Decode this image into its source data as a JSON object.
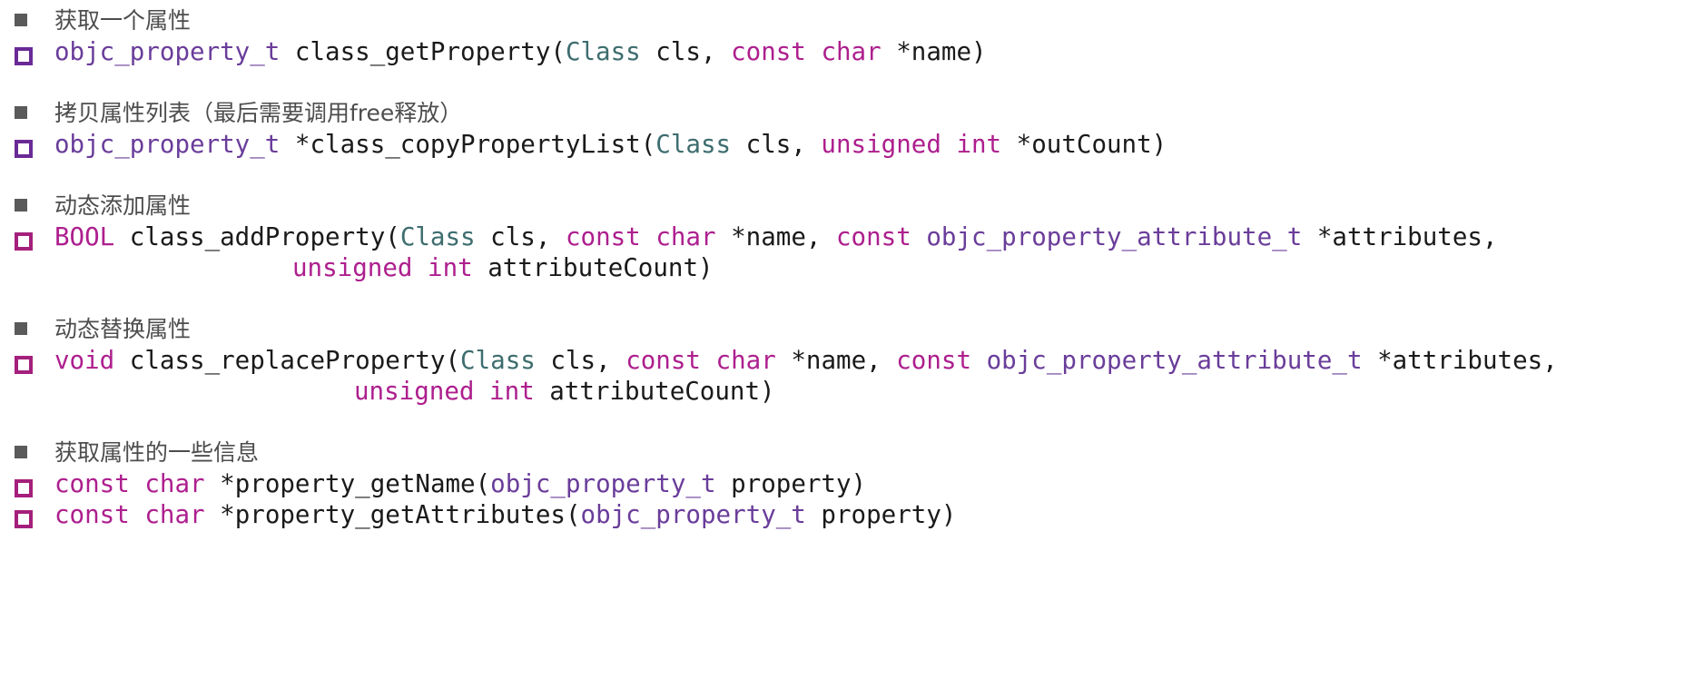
{
  "colors": {
    "keyword": "#ad1f8e",
    "type": "#6a3d9a",
    "class": "#3e6d6f",
    "plain": "#1a1a1a",
    "heading": "#4d4d4d",
    "bullet_square": "#5a5a5a",
    "bullet_hollow_purple": "#6a2a96",
    "bullet_hollow_magenta": "#a4207c"
  },
  "sections": [
    {
      "heading": "获取一个属性",
      "lines": [
        [
          {
            "t": "objc_property_t",
            "c": "ty"
          },
          {
            "t": " class_getProperty(",
            "c": "pl"
          },
          {
            "t": "Class",
            "c": "cl"
          },
          {
            "t": " cls, ",
            "c": "pl"
          },
          {
            "t": "const",
            "c": "kw"
          },
          {
            "t": " ",
            "c": "pl"
          },
          {
            "t": "char",
            "c": "kw"
          },
          {
            "t": " *name)",
            "c": "pl"
          }
        ]
      ]
    },
    {
      "heading": "拷贝属性列表（最后需要调用free释放）",
      "lines": [
        [
          {
            "t": "objc_property_t",
            "c": "ty"
          },
          {
            "t": " *class_copyPropertyList(",
            "c": "pl"
          },
          {
            "t": "Class",
            "c": "cl"
          },
          {
            "t": " cls, ",
            "c": "pl"
          },
          {
            "t": "unsigned",
            "c": "kw"
          },
          {
            "t": " ",
            "c": "pl"
          },
          {
            "t": "int",
            "c": "kw"
          },
          {
            "t": " *outCount)",
            "c": "pl"
          }
        ]
      ]
    },
    {
      "heading": "动态添加属性",
      "lines": [
        [
          {
            "t": "BOOL",
            "c": "kw"
          },
          {
            "t": " class_addProperty(",
            "c": "pl"
          },
          {
            "t": "Class",
            "c": "cl"
          },
          {
            "t": " cls, ",
            "c": "pl"
          },
          {
            "t": "const",
            "c": "kw"
          },
          {
            "t": " ",
            "c": "pl"
          },
          {
            "t": "char",
            "c": "kw"
          },
          {
            "t": " *name, ",
            "c": "pl"
          },
          {
            "t": "const",
            "c": "kw"
          },
          {
            "t": " ",
            "c": "pl"
          },
          {
            "t": "objc_property_attribute_t",
            "c": "ty"
          },
          {
            "t": " *attributes,",
            "c": "pl"
          }
        ],
        [
          {
            "t": "unsigned",
            "c": "kw"
          },
          {
            "t": " ",
            "c": "pl"
          },
          {
            "t": "int",
            "c": "kw"
          },
          {
            "t": " attributeCount)",
            "c": "pl"
          }
        ]
      ]
    },
    {
      "heading": "动态替换属性",
      "lines": [
        [
          {
            "t": "void",
            "c": "kw"
          },
          {
            "t": " class_replaceProperty(",
            "c": "pl"
          },
          {
            "t": "Class",
            "c": "cl"
          },
          {
            "t": " cls, ",
            "c": "pl"
          },
          {
            "t": "const",
            "c": "kw"
          },
          {
            "t": " ",
            "c": "pl"
          },
          {
            "t": "char",
            "c": "kw"
          },
          {
            "t": " *name, ",
            "c": "pl"
          },
          {
            "t": "const",
            "c": "kw"
          },
          {
            "t": " ",
            "c": "pl"
          },
          {
            "t": "objc_property_attribute_t",
            "c": "ty"
          },
          {
            "t": " *attributes,",
            "c": "pl"
          }
        ],
        [
          {
            "t": "unsigned",
            "c": "kw"
          },
          {
            "t": " ",
            "c": "pl"
          },
          {
            "t": "int",
            "c": "kw"
          },
          {
            "t": " attributeCount)",
            "c": "pl"
          }
        ]
      ]
    },
    {
      "heading": "获取属性的一些信息",
      "lines": [
        [
          {
            "t": "const",
            "c": "kw"
          },
          {
            "t": " ",
            "c": "pl"
          },
          {
            "t": "char",
            "c": "kw"
          },
          {
            "t": " *property_getName(",
            "c": "pl"
          },
          {
            "t": "objc_property_t",
            "c": "ty"
          },
          {
            "t": " property)",
            "c": "pl"
          }
        ],
        [
          {
            "t": "const",
            "c": "kw"
          },
          {
            "t": " ",
            "c": "pl"
          },
          {
            "t": "char",
            "c": "kw"
          },
          {
            "t": " *property_getAttributes(",
            "c": "pl"
          },
          {
            "t": "objc_property_t",
            "c": "ty"
          },
          {
            "t": " property)",
            "c": "pl"
          }
        ]
      ]
    }
  ]
}
